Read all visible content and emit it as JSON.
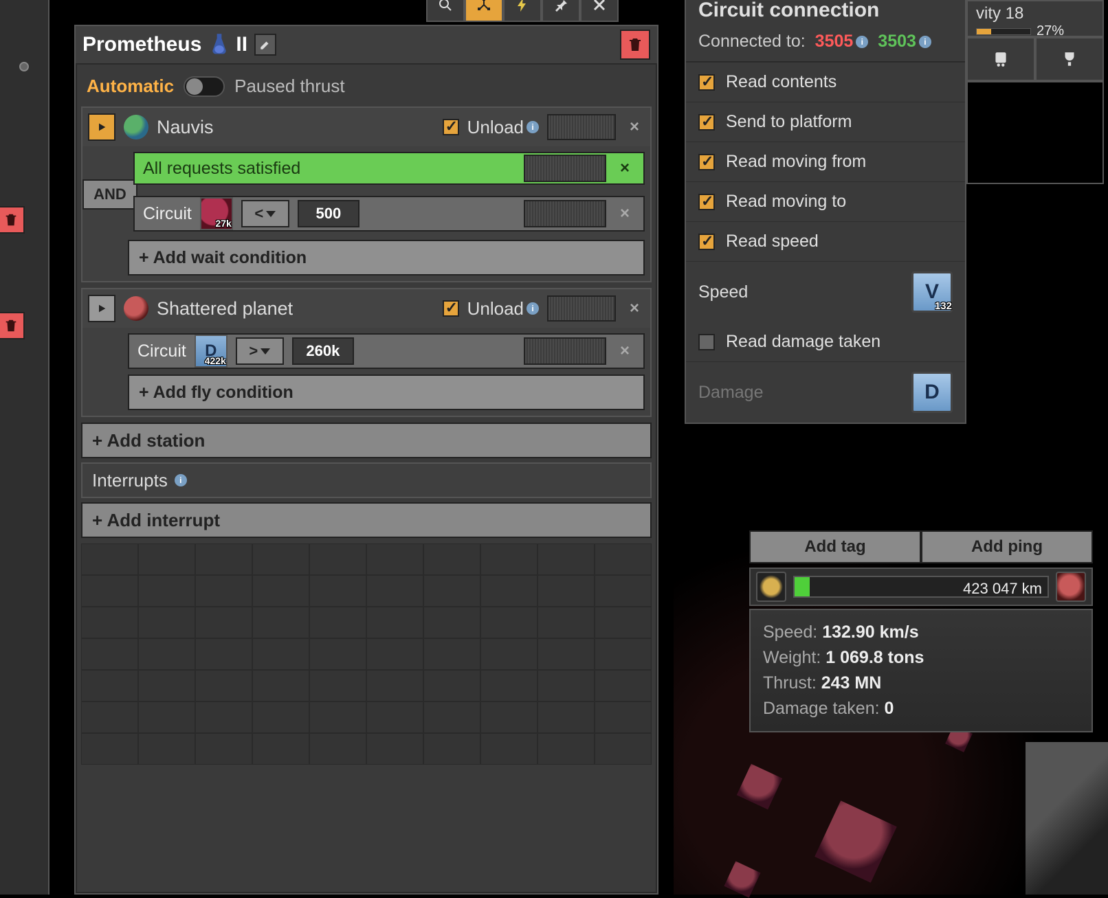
{
  "header": {
    "ship_name": "Prometheus",
    "level": "II"
  },
  "mode": {
    "auto_label": "Automatic",
    "paused_label": "Paused thrust",
    "is_automatic": true
  },
  "stations": [
    {
      "name": "Nauvis",
      "active": true,
      "unload_label": "Unload",
      "unload_checked": true,
      "and_label": "AND",
      "conditions": [
        {
          "type": "satisfied",
          "text": "All requests satisfied"
        },
        {
          "type": "circuit",
          "label": "Circuit",
          "item_badge": "27k",
          "op": "<",
          "value": "500"
        }
      ],
      "add_label": "+ Add wait condition"
    },
    {
      "name": "Shattered planet",
      "active": false,
      "unload_label": "Unload",
      "unload_checked": true,
      "conditions": [
        {
          "type": "circuit",
          "label": "Circuit",
          "signal_letter": "D",
          "item_badge": "422k",
          "op": ">",
          "value": "260k"
        }
      ],
      "add_label": "+ Add fly condition"
    }
  ],
  "add_station_label": "+ Add station",
  "interrupts_label": "Interrupts",
  "add_interrupt_label": "+ Add interrupt",
  "circuit": {
    "title": "Circuit connection",
    "connected_label": "Connected to:",
    "red_id": "3505",
    "green_id": "3503",
    "opts": {
      "read_contents": "Read contents",
      "send_platform": "Send to platform",
      "read_from": "Read moving from",
      "read_to": "Read moving to",
      "read_speed": "Read speed",
      "speed_label": "Speed",
      "speed_signal": "V",
      "speed_val": "132",
      "read_damage": "Read damage taken",
      "damage_label": "Damage",
      "damage_signal": "D"
    }
  },
  "hud": {
    "title": "vity 18",
    "pct": "27%"
  },
  "platform": {
    "add_tag": "Add tag",
    "add_ping": "Add ping",
    "distance": "423 047 km",
    "stats": {
      "speed_k": "Speed:",
      "speed_v": "132.90 km/s",
      "weight_k": "Weight:",
      "weight_v": "1 069.8 tons",
      "thrust_k": "Thrust:",
      "thrust_v": "243 MN",
      "dmg_k": "Damage taken:",
      "dmg_v": "0"
    }
  }
}
